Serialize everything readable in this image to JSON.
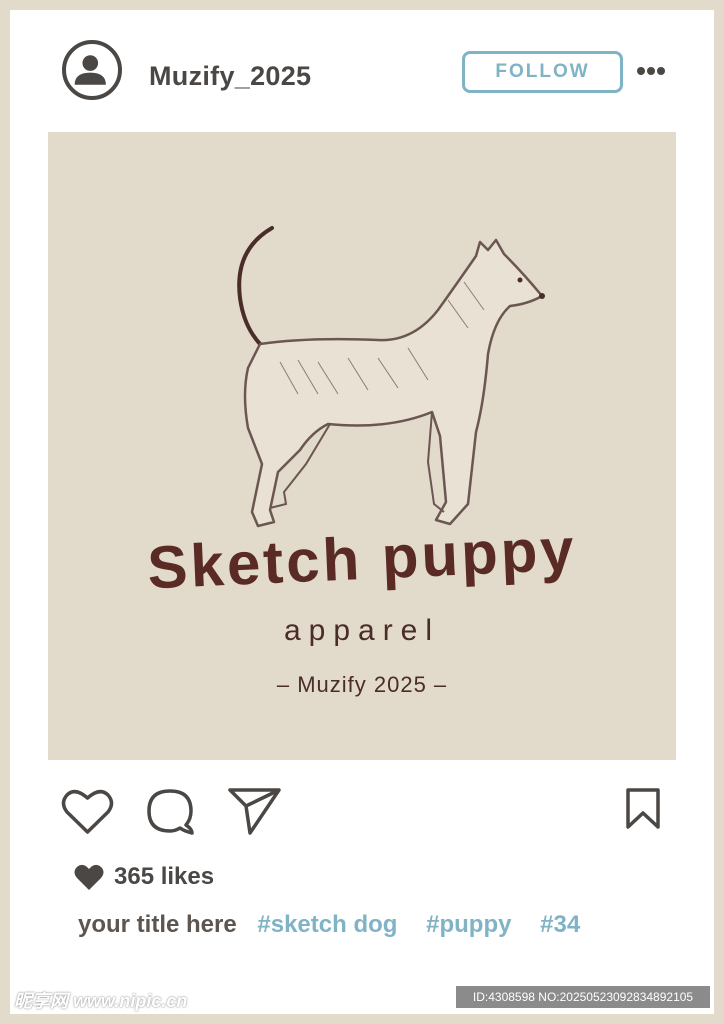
{
  "post": {
    "username": "Muzify_2025",
    "follow_label": "FOLLOW",
    "image": {
      "brand_title": "Sketch puppy",
      "brand_subtitle": "apparel",
      "brand_signature": "– Muzify 2025 –"
    },
    "likes": "365 likes",
    "caption": {
      "title": "your title here",
      "hashtags": [
        "#sketch dog",
        "#puppy",
        "#34"
      ]
    }
  },
  "icons": {
    "avatar": "user-avatar-icon",
    "more": "more-options-icon",
    "like": "heart-outline-icon",
    "comment": "comment-bubble-icon",
    "share": "send-paper-plane-icon",
    "save": "bookmark-icon",
    "likes": "heart-filled-icon"
  },
  "watermark": {
    "site": "昵享网 www.nipic.cn",
    "id_text": "ID:4308598 NO:20250523092834892105"
  },
  "colors": {
    "frame": "#e2dacb",
    "card": "#ffffff",
    "dark_text": "#4a4744",
    "accent_blue": "#7fb3c5",
    "brand_red": "#5a2a25"
  }
}
